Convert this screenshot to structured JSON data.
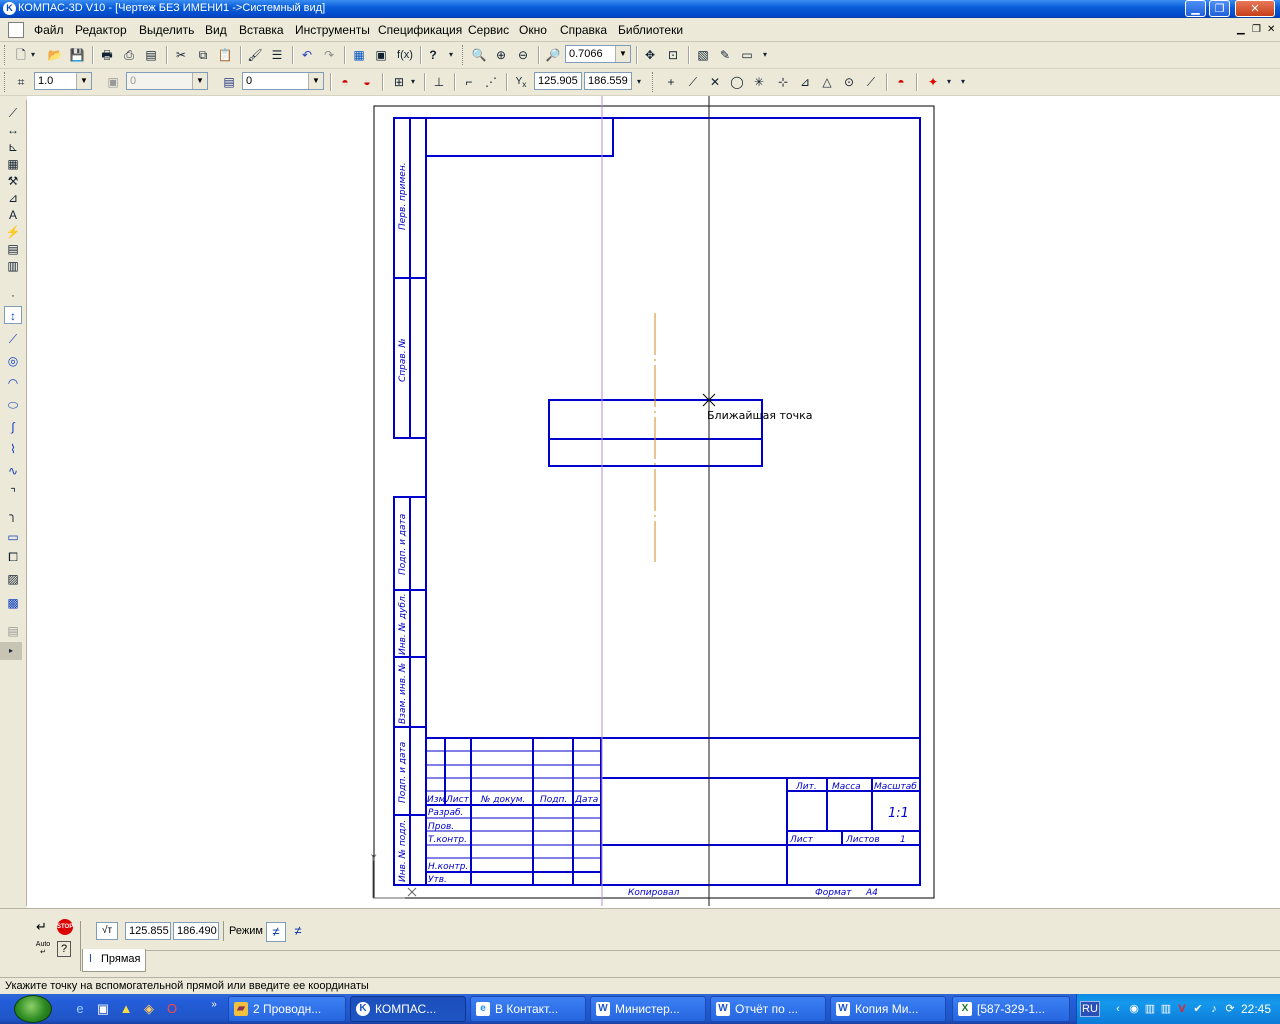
{
  "window": {
    "title": "КОМПАС-3D V10 - [Чертеж БЕЗ ИМЕНИ1 ->Системный вид]",
    "app_icon": "K"
  },
  "menu": [
    "Файл",
    "Редактор",
    "Выделить",
    "Вид",
    "Вставка",
    "Инструменты",
    "Спецификация",
    "Сервис",
    "Окно",
    "Справка",
    "Библиотеки"
  ],
  "toolbar_standard": {
    "fx_label": "f(x)",
    "zoom_value": "0.7066"
  },
  "toolbar_current": {
    "step_value": "1.0",
    "layer_state_value": "0",
    "layer_value": "0",
    "coord_x": "125.905",
    "coord_y": "186.559"
  },
  "drawing": {
    "tooltip": "Ближайшая точка",
    "stamp": {
      "lit": "Лит.",
      "massa": "Масса",
      "masshtab": "Масштаб",
      "scale_value": "1:1",
      "list": "Лист",
      "listov": "Листов",
      "listov_value": "1",
      "izm": "Изм.",
      "list_col": "Лист",
      "dokum": "№ докум.",
      "podp": "Подп.",
      "data": "Дата",
      "razrab": "Разраб.",
      "prov": "Пров.",
      "tkontr": "Т.контр.",
      "nkontr": "Н.контр.",
      "utv": "Утв.",
      "kopiroval": "Копировал",
      "format_label": "Формат",
      "format_value": "A4"
    },
    "side_labels": [
      "Перв. примен.",
      "Справ. №",
      "Подп. и дата",
      "Инв. № дубл.",
      "Взам. инв. №",
      "Подп. и дата",
      "Инв. № подл."
    ]
  },
  "property_bar": {
    "coord_x": "125.855",
    "coord_y": "186.490",
    "mode_label": "Режим",
    "tab_label": "Прямая",
    "auto_label": "Auto",
    "stop_label": "STOP"
  },
  "status": {
    "text": "Укажите точку на вспомогательной прямой или введите ее координаты"
  },
  "taskbar": {
    "tasks": [
      {
        "label": "2 Проводн...",
        "icon": "folder-icon"
      },
      {
        "label": "КОМПАС...",
        "icon": "kompas-icon"
      },
      {
        "label": "В Контакт...",
        "icon": "ie-icon"
      },
      {
        "label": "Министер...",
        "icon": "word-icon"
      },
      {
        "label": "Отчёт по ...",
        "icon": "word-icon"
      },
      {
        "label": "Копия Ми...",
        "icon": "word-icon"
      },
      {
        "label": "[587-329-1...",
        "icon": "excel-icon"
      }
    ],
    "language": "RU",
    "clock": "22:45"
  },
  "colors": {
    "frame_blue": "#0000cc",
    "axis_orange": "#d08a20",
    "aux_line": "#1a1a1a",
    "aux_line_violet": "#b48cd8",
    "titlebar": "#0a5ed8"
  }
}
